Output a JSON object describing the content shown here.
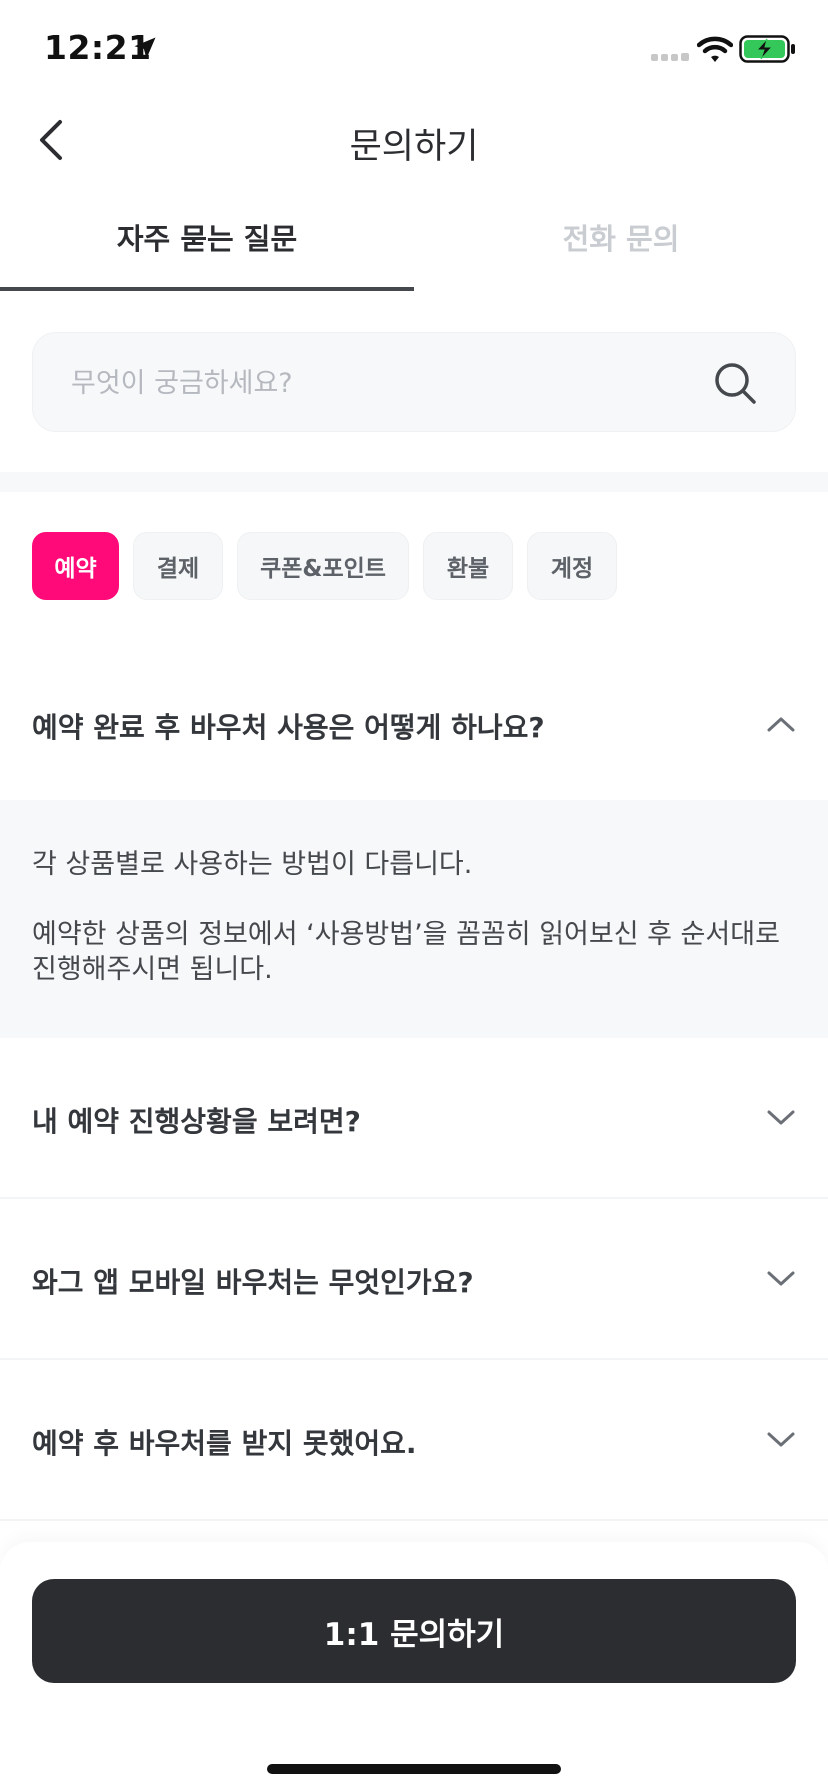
{
  "status_bar": {
    "time": "12:21",
    "icons": [
      "location-arrow-icon",
      "cellular-signal-icon",
      "wifi-icon",
      "battery-charging-icon"
    ],
    "battery_color": "#34c759"
  },
  "header": {
    "back_icon": "chevron-left-icon",
    "title": "문의하기"
  },
  "tabs": [
    {
      "label": "자주 묻는 질문",
      "active": true
    },
    {
      "label": "전화 문의",
      "active": false
    }
  ],
  "search": {
    "placeholder": "무엇이 궁금하세요?",
    "value": "",
    "icon": "search-icon"
  },
  "categories": [
    {
      "label": "예약",
      "active": true
    },
    {
      "label": "결제",
      "active": false
    },
    {
      "label": "쿠폰&포인트",
      "active": false
    },
    {
      "label": "환불",
      "active": false
    },
    {
      "label": "계정",
      "active": false
    }
  ],
  "faqs": [
    {
      "question": "예약 완료 후 바우처 사용은 어떻게 하나요?",
      "expanded": true,
      "answer_lines": [
        "각 상품별로 사용하는 방법이 다릅니다.",
        "예약한 상품의 정보에서 ‘사용방법’을 꼼꼼히 읽어보신 후 순서대로",
        "진행해주시면 됩니다."
      ]
    },
    {
      "question": "내 예약 진행상황을 보려면?",
      "expanded": false
    },
    {
      "question": "와그 앱 모바일 바우처는 무엇인가요?",
      "expanded": false
    },
    {
      "question": "예약 후 바우처를 받지 못했어요.",
      "expanded": false
    }
  ],
  "footer": {
    "inquiry_button": "1:1 문의하기"
  },
  "colors": {
    "accent": "#ff0a78",
    "dark_button": "#2b2d31",
    "inactive_tab": "#c9ccd1"
  }
}
